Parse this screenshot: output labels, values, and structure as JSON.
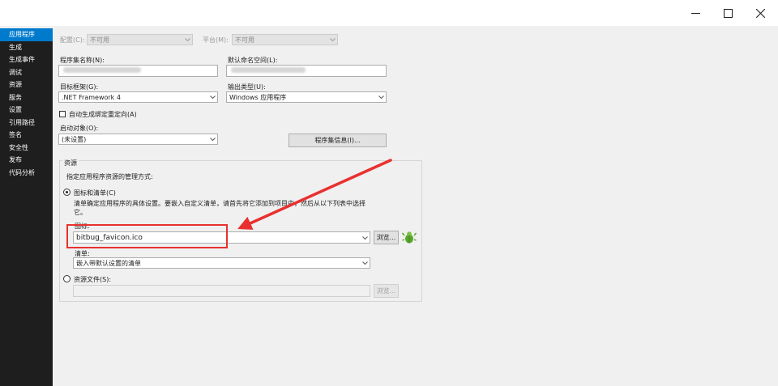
{
  "window": {
    "minimize_glyph": "–",
    "maximize_glyph": "□",
    "close_glyph": "✕"
  },
  "sidebar": {
    "items": [
      {
        "label": "应用程序",
        "active": true
      },
      {
        "label": "生成"
      },
      {
        "label": "生成事件"
      },
      {
        "label": "调试"
      },
      {
        "label": "资源"
      },
      {
        "label": "服务"
      },
      {
        "label": "设置"
      },
      {
        "label": "引用路径"
      },
      {
        "label": "签名"
      },
      {
        "label": "安全性"
      },
      {
        "label": "发布"
      },
      {
        "label": "代码分析"
      }
    ]
  },
  "toolbar": {
    "config_label": "配置(C):",
    "config_value": "不可用",
    "platform_label": "平台(M):",
    "platform_value": "不可用"
  },
  "app": {
    "assembly_name_label": "程序集名称(N):",
    "assembly_name_value": "",
    "default_namespace_label": "默认命名空间(L):",
    "default_namespace_value": "",
    "target_framework_label": "目标框架(G):",
    "target_framework_value": ".NET Framework 4",
    "output_type_label": "输出类型(U):",
    "output_type_value": "Windows 应用程序",
    "auto_binding_label": "自动生成绑定重定向(A)",
    "startup_object_label": "启动对象(O):",
    "startup_object_value": "(未设置)",
    "assembly_info_button": "程序集信息(I)..."
  },
  "resources": {
    "group_title": "资源",
    "description": "指定应用程序资源的管理方式:",
    "icon_manifest_label": "图标和清单(C)",
    "icon_manifest_help_line1": "清单确定应用程序的具体设置。要嵌入自定义清单，请首先将它添加到项目中，然后从以下列表中选择",
    "icon_manifest_help_line2": "它。",
    "icon_label": "图标:",
    "icon_value": "bitbug_favicon.ico",
    "browse_label": "浏览...",
    "manifest_label": "清单:",
    "manifest_value": "嵌入带默认设置的清单",
    "resource_file_label": "资源文件(S):",
    "resource_browse_label": "浏览..."
  },
  "annotation": {
    "color": "#e8312f"
  }
}
